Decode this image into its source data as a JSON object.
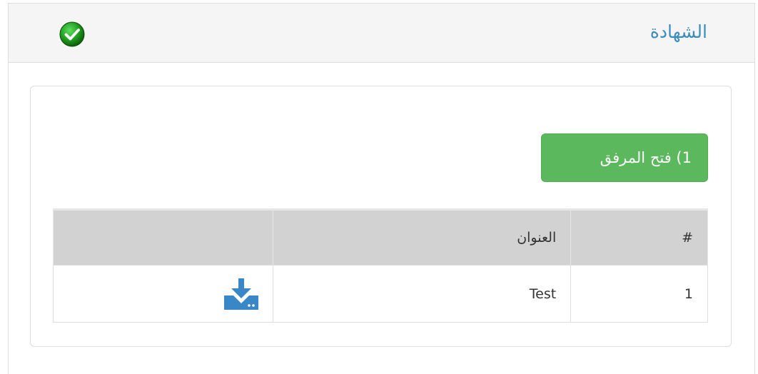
{
  "panel": {
    "title": "الشهادة",
    "status_icon": "check-circle-icon",
    "status_color": "#1f9d1f"
  },
  "actions": {
    "open_attachment_label": "1) فتح المرفق",
    "button_color": "#5cb85c"
  },
  "table": {
    "headers": [
      "#",
      "العنوان",
      ""
    ],
    "rows": [
      {
        "num": "1",
        "title": "Test",
        "action_icon": "download-icon"
      }
    ],
    "header_bg": "#d2d2d2"
  },
  "colors": {
    "title": "#3c8dbc",
    "download_icon": "#3a87c8"
  }
}
